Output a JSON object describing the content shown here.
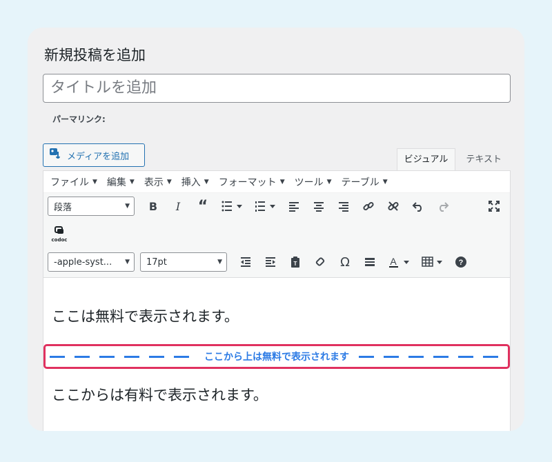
{
  "page": {
    "heading": "新規投稿を追加",
    "title_placeholder": "タイトルを追加",
    "permalink_label": "パーマリンク:"
  },
  "media_button": {
    "label": "メディアを追加",
    "icon": "media-add-icon"
  },
  "editor_tabs": [
    {
      "label": "ビジュアル",
      "active": true
    },
    {
      "label": "テキスト",
      "active": false
    }
  ],
  "menubar": [
    "ファイル",
    "編集",
    "表示",
    "挿入",
    "フォーマット",
    "ツール",
    "テーブル"
  ],
  "toolbar": {
    "paragraph_select": "段落",
    "font_family_select": "-apple-syst...",
    "font_size_select": "17pt",
    "codoc_label": "codoc",
    "row1_icons": [
      "bold-icon",
      "italic-icon",
      "blockquote-icon",
      "bullet-list-icon",
      "numbered-list-icon",
      "align-left-icon",
      "align-center-icon",
      "align-right-icon",
      "link-icon",
      "unlink-icon",
      "undo-icon",
      "redo-icon",
      "fullscreen-icon"
    ],
    "row3_icons": [
      "outdent-icon",
      "indent-icon",
      "paste-text-icon",
      "clear-formatting-icon",
      "special-character-icon",
      "horizontal-rule-icon",
      "text-color-icon",
      "table-icon",
      "help-icon"
    ]
  },
  "content": {
    "free_paragraph": "ここは無料で表示されます。",
    "divider_text": "ここから上は無料で表示されます",
    "paid_paragraph": "ここからは有料で表示されます。"
  },
  "colors": {
    "divider_border": "#e0315f",
    "divider_text": "#2c7be5",
    "accent": "#2271b1"
  }
}
